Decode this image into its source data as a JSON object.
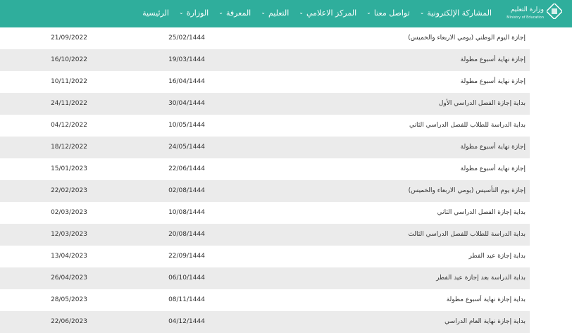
{
  "header": {
    "logo_text_ar": "وزارة التعليم",
    "logo_text_en": "Ministry of Education",
    "nav": [
      {
        "label": "الرئيسية",
        "has_dropdown": false
      },
      {
        "label": "الوزارة",
        "has_dropdown": true
      },
      {
        "label": "المعرفة",
        "has_dropdown": true
      },
      {
        "label": "التعليم",
        "has_dropdown": true
      },
      {
        "label": "المركز الاعلامي",
        "has_dropdown": true
      },
      {
        "label": "تواصل معنا",
        "has_dropdown": true
      },
      {
        "label": "المشاركة الإلكترونية",
        "has_dropdown": true
      }
    ],
    "dropdown_glyph": "⌄",
    "bar_color": "#2fae9c"
  },
  "table": {
    "rows": [
      {
        "title": "إجازة اليوم الوطني (يومي الاربعاء والخميس)",
        "hijri": "25/02/1444",
        "gregorian": "21/09/2022"
      },
      {
        "title": "إجازة نهاية أسبوع مطولة",
        "hijri": "19/03/1444",
        "gregorian": "16/10/2022"
      },
      {
        "title": "إجازة نهاية أسبوع مطولة",
        "hijri": "16/04/1444",
        "gregorian": "10/11/2022"
      },
      {
        "title": "بداية إجازة الفصل الدراسي الأول",
        "hijri": "30/04/1444",
        "gregorian": "24/11/2022"
      },
      {
        "title": "بداية الدراسة للطلاب للفصل الدراسي الثاني",
        "hijri": "10/05/1444",
        "gregorian": "04/12/2022"
      },
      {
        "title": "إجازة نهاية أسبوع مطولة",
        "hijri": "24/05/1444",
        "gregorian": "18/12/2022"
      },
      {
        "title": "إجازة نهاية أسبوع مطولة",
        "hijri": "22/06/1444",
        "gregorian": "15/01/2023"
      },
      {
        "title": "إجازة يوم التأسيس (يومي الاربعاء والخميس)",
        "hijri": "02/08/1444",
        "gregorian": "22/02/2023"
      },
      {
        "title": "بداية إجازة الفصل الدراسي الثاني",
        "hijri": "10/08/1444",
        "gregorian": "02/03/2023"
      },
      {
        "title": "بداية الدراسة للطلاب للفصل الدراسي الثالث",
        "hijri": "20/08/1444",
        "gregorian": "12/03/2023"
      },
      {
        "title": "بداية إجازة عيد الفطر",
        "hijri": "22/09/1444",
        "gregorian": "13/04/2023"
      },
      {
        "title": "بداية الدراسة بعد إجازة عيد الفطر",
        "hijri": "06/10/1444",
        "gregorian": "26/04/2023"
      },
      {
        "title": "بداية إجازة نهاية أسبوع مطولة",
        "hijri": "08/11/1444",
        "gregorian": "28/05/2023"
      },
      {
        "title": "بداية إجازة نهاية العام الدراسي",
        "hijri": "04/12/1444",
        "gregorian": "22/06/2023"
      }
    ],
    "alt_row_color": "#ebebeb"
  }
}
